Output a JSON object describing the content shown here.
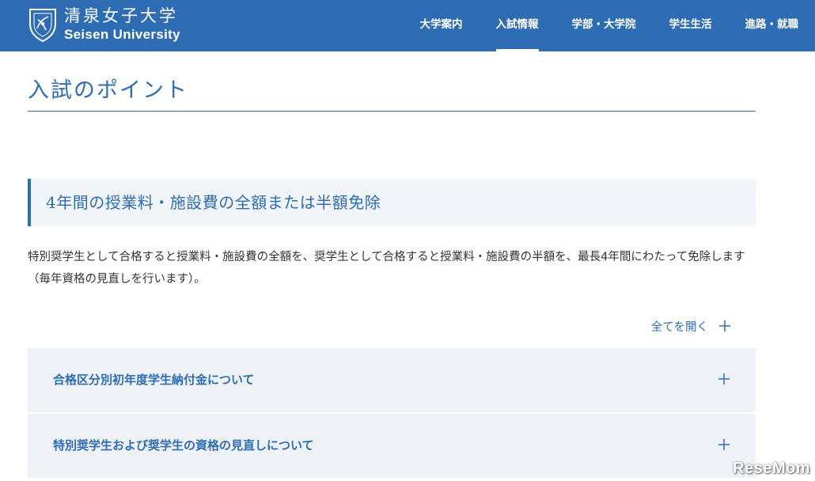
{
  "header": {
    "logo_ja": "清泉女子大学",
    "logo_en": "Seisen University",
    "logo_icon": "seisen-crest-icon",
    "nav": [
      {
        "label": "大学案内",
        "active": false
      },
      {
        "label": "入試情報",
        "active": true
      },
      {
        "label": "学部・大学院",
        "active": false
      },
      {
        "label": "学生生活",
        "active": false
      },
      {
        "label": "進路・就職",
        "active": false
      }
    ]
  },
  "page": {
    "title": "入試のポイント"
  },
  "section": {
    "heading": "4年間の授業料・施設費の全額または半額免除",
    "body": "特別奨学生として合格すると授業料・施設費の全額を、奨学生として合格すると授業料・施設費の半額を、最長4年間にわたって免除します（毎年資格の見直しを行います）。"
  },
  "accordion": {
    "open_all_label": "全てを開く",
    "expand_icon": "plus-icon",
    "items": [
      {
        "label": "合格区分別初年度学生納付金について"
      },
      {
        "label": "特別奨学生および奨学生の資格の見直しについて"
      }
    ]
  },
  "watermark": {
    "text": "ReseMom"
  },
  "colors": {
    "brand": "#2e6db4",
    "panel_bg": "#eef2f7",
    "body_text": "#333333"
  }
}
